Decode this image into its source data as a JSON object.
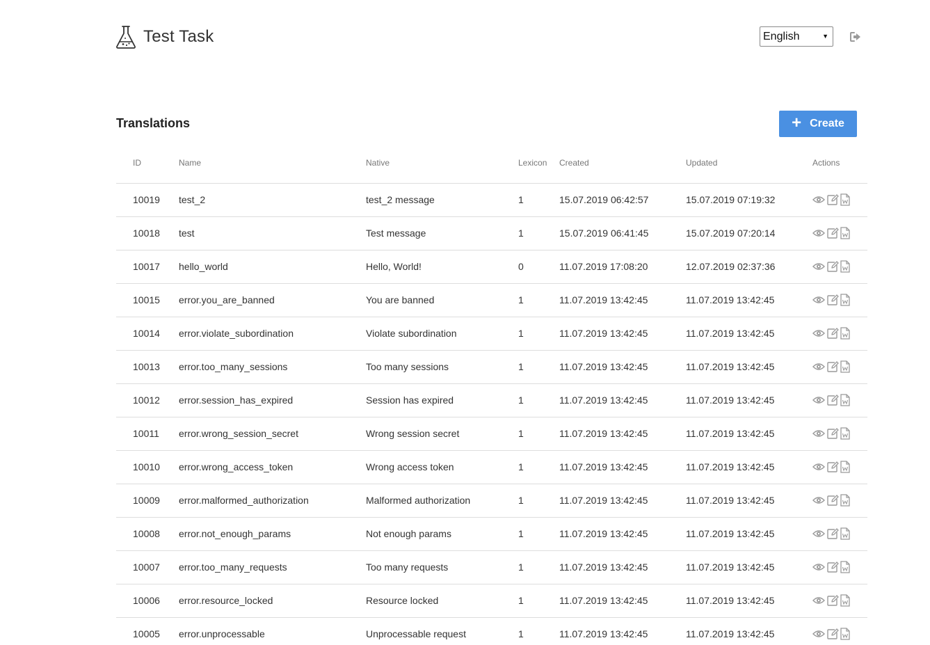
{
  "app": {
    "title": "Test Task",
    "logo_icon": "flask-icon"
  },
  "header": {
    "language": {
      "selected": "English"
    },
    "logout_icon": "sign-out-icon"
  },
  "section": {
    "title": "Translations",
    "create_label": "Create"
  },
  "colors": {
    "accent": "#4a90e2",
    "icon_gray": "#9a9a9a",
    "border": "#dddddd"
  },
  "table": {
    "columns": {
      "id": "ID",
      "name": "Name",
      "native": "Native",
      "lexicon": "Lexicon",
      "created": "Created",
      "updated": "Updated",
      "actions": "Actions"
    },
    "rows": [
      {
        "id": "10019",
        "name": "test_2",
        "native": "test_2 message",
        "lexicon": "1",
        "created": "15.07.2019 06:42:57",
        "updated": "15.07.2019 07:19:32"
      },
      {
        "id": "10018",
        "name": "test",
        "native": "Test message",
        "lexicon": "1",
        "created": "15.07.2019 06:41:45",
        "updated": "15.07.2019 07:20:14"
      },
      {
        "id": "10017",
        "name": "hello_world",
        "native": "Hello, World!",
        "lexicon": "0",
        "created": "11.07.2019 17:08:20",
        "updated": "12.07.2019 02:37:36"
      },
      {
        "id": "10015",
        "name": "error.you_are_banned",
        "native": "You are banned",
        "lexicon": "1",
        "created": "11.07.2019 13:42:45",
        "updated": "11.07.2019 13:42:45"
      },
      {
        "id": "10014",
        "name": "error.violate_subordination",
        "native": "Violate subordination",
        "lexicon": "1",
        "created": "11.07.2019 13:42:45",
        "updated": "11.07.2019 13:42:45"
      },
      {
        "id": "10013",
        "name": "error.too_many_sessions",
        "native": "Too many sessions",
        "lexicon": "1",
        "created": "11.07.2019 13:42:45",
        "updated": "11.07.2019 13:42:45"
      },
      {
        "id": "10012",
        "name": "error.session_has_expired",
        "native": "Session has expired",
        "lexicon": "1",
        "created": "11.07.2019 13:42:45",
        "updated": "11.07.2019 13:42:45"
      },
      {
        "id": "10011",
        "name": "error.wrong_session_secret",
        "native": "Wrong session secret",
        "lexicon": "1",
        "created": "11.07.2019 13:42:45",
        "updated": "11.07.2019 13:42:45"
      },
      {
        "id": "10010",
        "name": "error.wrong_access_token",
        "native": "Wrong access token",
        "lexicon": "1",
        "created": "11.07.2019 13:42:45",
        "updated": "11.07.2019 13:42:45"
      },
      {
        "id": "10009",
        "name": "error.malformed_authorization",
        "native": "Malformed authorization",
        "lexicon": "1",
        "created": "11.07.2019 13:42:45",
        "updated": "11.07.2019 13:42:45"
      },
      {
        "id": "10008",
        "name": "error.not_enough_params",
        "native": "Not enough params",
        "lexicon": "1",
        "created": "11.07.2019 13:42:45",
        "updated": "11.07.2019 13:42:45"
      },
      {
        "id": "10007",
        "name": "error.too_many_requests",
        "native": "Too many requests",
        "lexicon": "1",
        "created": "11.07.2019 13:42:45",
        "updated": "11.07.2019 13:42:45"
      },
      {
        "id": "10006",
        "name": "error.resource_locked",
        "native": "Resource locked",
        "lexicon": "1",
        "created": "11.07.2019 13:42:45",
        "updated": "11.07.2019 13:42:45"
      },
      {
        "id": "10005",
        "name": "error.unprocessable",
        "native": "Unprocessable request",
        "lexicon": "1",
        "created": "11.07.2019 13:42:45",
        "updated": "11.07.2019 13:42:45"
      }
    ],
    "row_action_icons": [
      "eye-icon",
      "edit-icon",
      "word-file-icon"
    ]
  }
}
